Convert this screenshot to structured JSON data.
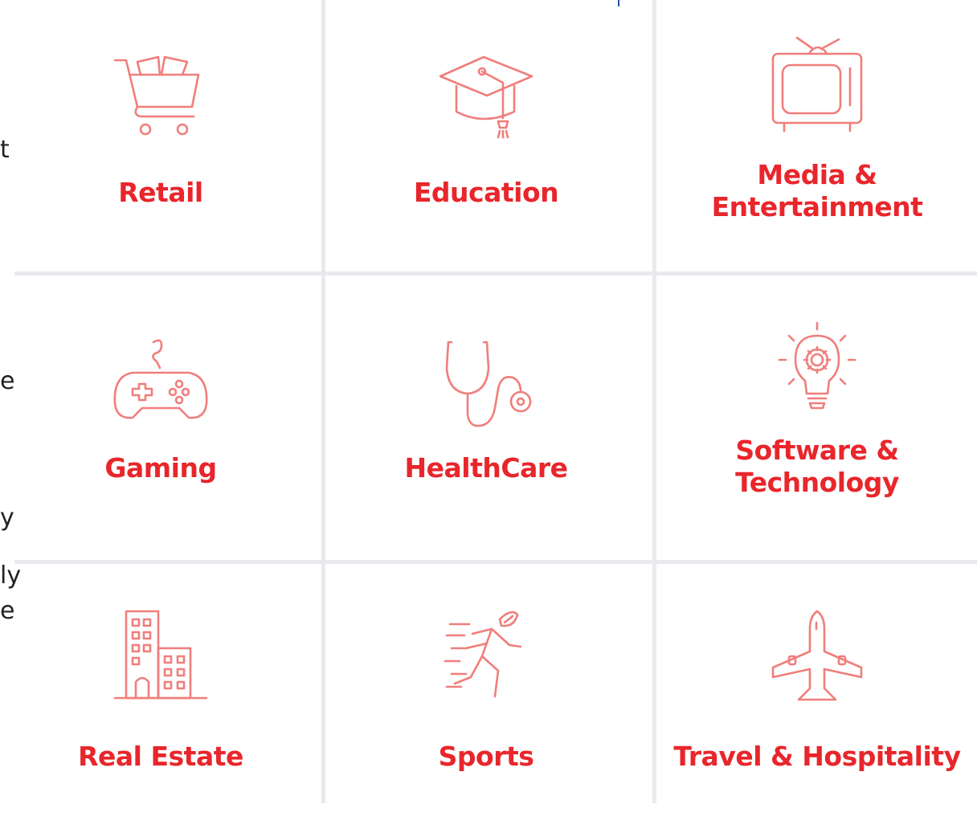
{
  "left_column_fragments": [
    "t",
    "e",
    "y",
    "ly",
    "e"
  ],
  "accent_color": "#e8262b",
  "icon_color": "#f07e7b",
  "industries": [
    {
      "label": "Retail",
      "icon": "shopping-cart-icon"
    },
    {
      "label": "Education",
      "icon": "graduation-cap-icon"
    },
    {
      "label": "Media & Entertainment",
      "line1": "Media &",
      "line2": "Entertainment",
      "icon": "tv-icon"
    },
    {
      "label": "Gaming",
      "icon": "gamepad-icon"
    },
    {
      "label": "HealthCare",
      "icon": "stethoscope-icon"
    },
    {
      "label": "Software & Technology",
      "line1": "Software &",
      "line2": "Technology",
      "icon": "lightbulb-gear-icon"
    },
    {
      "label": "Real Estate",
      "icon": "building-icon"
    },
    {
      "label": "Sports",
      "icon": "runner-icon"
    },
    {
      "label": "Travel & Hospitality",
      "icon": "airplane-icon"
    }
  ]
}
